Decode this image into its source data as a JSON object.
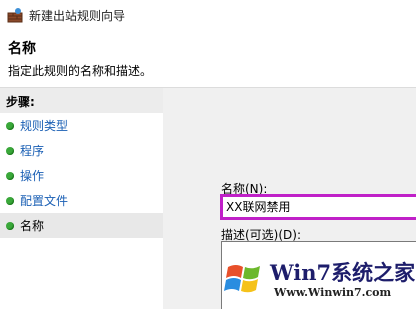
{
  "window": {
    "title": "新建出站规则向导",
    "icon": "firewall-wizard-icon"
  },
  "header": {
    "title": "名称",
    "description": "指定此规则的名称和描述。"
  },
  "sidebar": {
    "steps_label": "步骤:",
    "items": [
      {
        "label": "规则类型",
        "state": "completed"
      },
      {
        "label": "程序",
        "state": "completed"
      },
      {
        "label": "操作",
        "state": "completed"
      },
      {
        "label": "配置文件",
        "state": "completed"
      },
      {
        "label": "名称",
        "state": "current"
      }
    ]
  },
  "form": {
    "name_label": "名称(N):",
    "name_value": "XX联网禁用",
    "description_label": "描述(可选)(D):",
    "description_value": ""
  },
  "watermark": {
    "brand": "Win7系统之家",
    "url": "Www.Winwin7.com"
  },
  "colors": {
    "highlight_border": "#c020c8",
    "step_link": "#1a5fb4",
    "bullet": "#3aa83a"
  }
}
